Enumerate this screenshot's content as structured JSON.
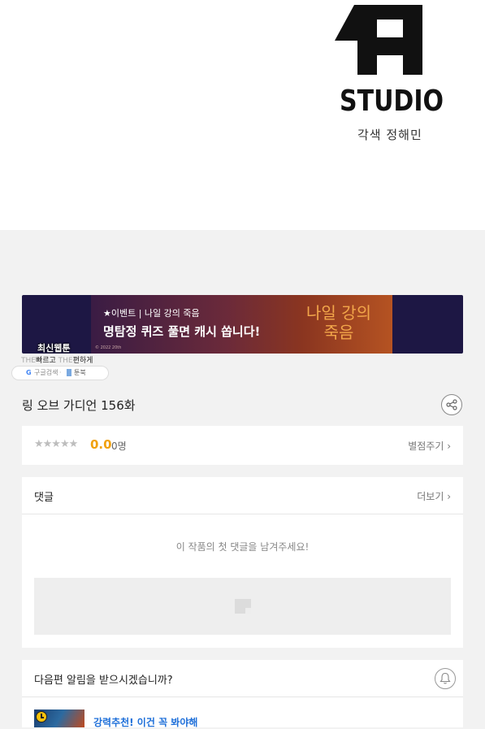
{
  "header": {
    "studio_logo_text": "STUDIO",
    "credit": "각색 정해민"
  },
  "banner": {
    "event": "★이벤트 | 나일 강의 죽음",
    "headline": "명탐정 퀴즈 풀면 캐시 쏩니다!",
    "title_line1": "나일 강의",
    "title_line2": "죽음",
    "fine_print": "© 2022 20th"
  },
  "badge": {
    "title": "최신웹툰",
    "sub_prefix": "THE",
    "sub_fast": "빠르고",
    "sub_prefix2": "THE",
    "sub_easy": "편하게",
    "google_letter": "G",
    "google_search": "구글검색",
    "sep": "·",
    "toonbook": "툰북"
  },
  "episode": {
    "title": "링 오브 가디언 156화"
  },
  "rating": {
    "stars": "★★★★★",
    "score": "0.0",
    "count": "0명",
    "rate_button": "별점주기 ›"
  },
  "comments": {
    "label": "댓글",
    "more_button": "더보기 ›",
    "empty_message": "이 작품의 첫 댓글을 남겨주세요!"
  },
  "notify": {
    "label": "다음편 알림을 받으시겠습니까?"
  },
  "recommend": {
    "text": "강력추천! 이건 꼭 봐야해"
  },
  "colors": {
    "score": "#f1a10e",
    "link": "#1e6fd9",
    "banner_bg": "#1d1744",
    "banner_title": "#f2a64a"
  }
}
